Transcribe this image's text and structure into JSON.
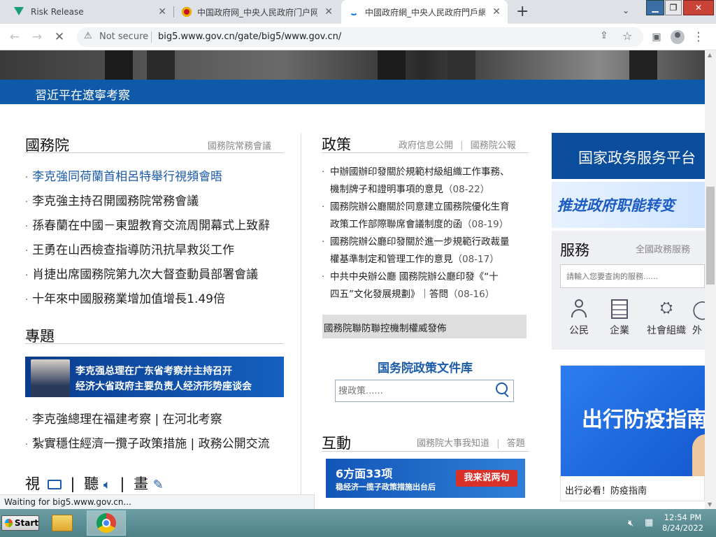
{
  "browser": {
    "tabs": [
      {
        "title": "Risk Release",
        "icon": "vuetify-logo-icon",
        "active": false
      },
      {
        "title": "中国政府网_中央人民政府门户网",
        "icon": "national-emblem-icon",
        "active": false
      },
      {
        "title": "中國政府網_中央人民政府門戶網",
        "icon": "loading-spinner-icon",
        "active": true
      }
    ],
    "new_tab": "+",
    "security_label": "Not secure",
    "url": "big5.www.gov.cn/gate/big5/www.gov.cn/",
    "status_text": "Waiting for big5.www.gov.cn..."
  },
  "page": {
    "banner_caption": "習近平在遼寧考察",
    "state_council": {
      "title": "國務院",
      "more": "國務院常務會議",
      "items": [
        "李克強同荷蘭首相呂特舉行視頻會晤",
        "李克強主持召開國務院常務會議",
        "孫春蘭在中國－東盟教育交流周開幕式上致辭",
        "王勇在山西檢查指導防汛抗旱救災工作",
        "肖捷出席國務院第九次大督查動員部署會議",
        "十年來中國服務業增加值增長1.49倍"
      ]
    },
    "topics": {
      "title": "專題",
      "banner_line1": "李克强总理在广东省考察并主持召开",
      "banner_line2": "经济大省政府主要负责人经济形势座谈会",
      "items": [
        "李克強總理在福建考察 | 在河北考察",
        "紮實穩住經濟一攬子政策措施 | 政務公開交流"
      ]
    },
    "media": {
      "video": "視",
      "listen": "聽",
      "draw": "畫"
    },
    "policy": {
      "title": "政策",
      "more1": "政府信息公開",
      "more2": "國務院公報",
      "items": [
        {
          "line1": "中辦國辦印發關於規範村級組織工作事務、",
          "line2": "機制牌子和證明事項的意見",
          "date": "（08-22）"
        },
        {
          "line1": "國務院辦公廳關於同意建立國務院優化生育",
          "line2": "政策工作部際聯席會議制度的函",
          "date": "（08-19）"
        },
        {
          "line1": "國務院辦公廳印發關於進一步規範行政裁量",
          "line2": "權基準制定和管理工作的意見",
          "date": "（08-17）"
        },
        {
          "line1": "中共中央辦公廳 國務院辦公廳印發《“十",
          "line2": "四五”文化發展規劃》｜答問",
          "date": "（08-16）"
        }
      ],
      "highlight": "國務院聯防聯控機制權威發佈",
      "library_title": "国务院政策文件库",
      "search_placeholder": "搜政策......"
    },
    "interaction": {
      "title": "互動",
      "more1": "國務院大事我知道",
      "more2": "答題",
      "banner_big": "6方面33项",
      "banner_small": "稳经济一揽子政策措施出台后",
      "banner_button": "我来说两句"
    },
    "right": {
      "platform_title": "国家政务服务平台",
      "promo_text": "推进政府职能转变",
      "service_title": "服務",
      "service_more": "全國政務服務",
      "service_search_placeholder": "請輸入您要查詢的服務......",
      "service_icons": [
        {
          "label": "公民",
          "icon": "person-icon"
        },
        {
          "label": "企業",
          "icon": "building-icon"
        },
        {
          "label": "社會組織",
          "icon": "org-chart-icon"
        },
        {
          "label": "外",
          "icon": "globe-icon"
        }
      ],
      "epidemic_banner": "出行防疫指南",
      "epidemic_caption": "出行必看！防疫指南"
    }
  },
  "taskbar": {
    "start_label": "Start",
    "time": "12:54 PM",
    "date": "8/24/2022"
  },
  "colors": {
    "brand_blue": "#0f5aa8",
    "link_blue": "#1b5ba8",
    "taskbar": "#5b8e94"
  }
}
